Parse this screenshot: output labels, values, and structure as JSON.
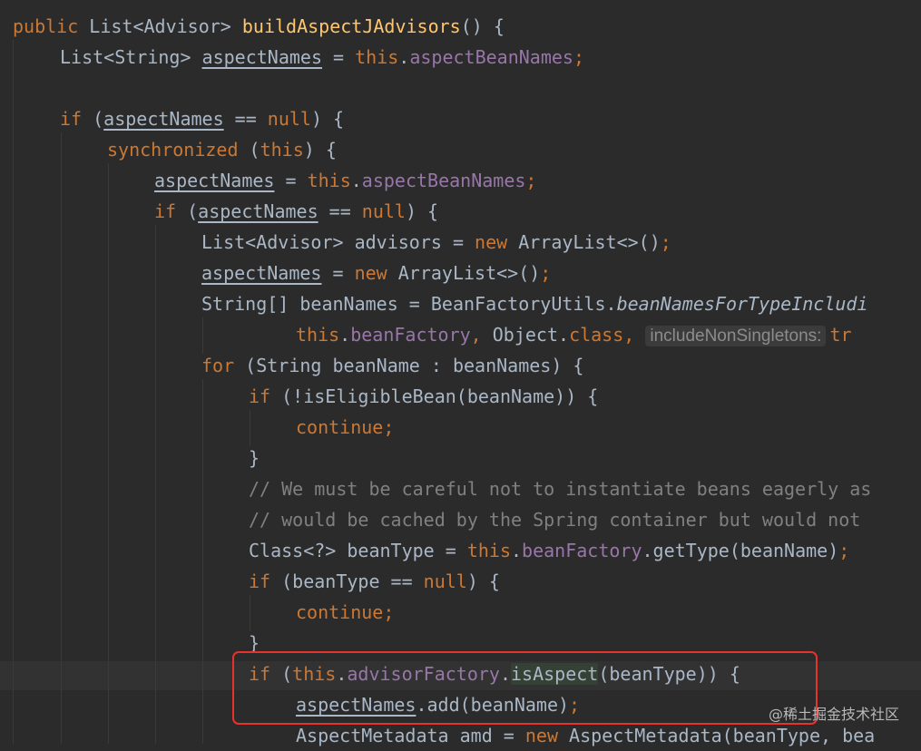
{
  "editor": {
    "lines": [
      {
        "indent": 0,
        "tokens": [
          {
            "t": "public ",
            "c": "kw"
          },
          {
            "t": "List<Advisor> ",
            "c": "pl"
          },
          {
            "t": "buildAspectJAdvisors",
            "c": "fn"
          },
          {
            "t": "() {",
            "c": "pl"
          }
        ]
      },
      {
        "indent": 1,
        "tokens": [
          {
            "t": "List<String> ",
            "c": "pl"
          },
          {
            "t": "aspectNames",
            "c": "pl ul"
          },
          {
            "t": " = ",
            "c": "pl"
          },
          {
            "t": "this",
            "c": "kw"
          },
          {
            "t": ".",
            "c": "pl"
          },
          {
            "t": "aspectBeanNames",
            "c": "fld"
          },
          {
            "t": ";",
            "c": "kw"
          }
        ]
      },
      {
        "indent": 0,
        "tokens": []
      },
      {
        "indent": 1,
        "tokens": [
          {
            "t": "if ",
            "c": "kw"
          },
          {
            "t": "(",
            "c": "pl"
          },
          {
            "t": "aspectNames",
            "c": "pl ul"
          },
          {
            "t": " == ",
            "c": "pl"
          },
          {
            "t": "null",
            "c": "kw"
          },
          {
            "t": ") {",
            "c": "pl"
          }
        ]
      },
      {
        "indent": 2,
        "tokens": [
          {
            "t": "synchronized ",
            "c": "kw"
          },
          {
            "t": "(",
            "c": "pl"
          },
          {
            "t": "this",
            "c": "kw"
          },
          {
            "t": ") {",
            "c": "pl"
          }
        ]
      },
      {
        "indent": 3,
        "tokens": [
          {
            "t": "aspectNames",
            "c": "pl ul"
          },
          {
            "t": " = ",
            "c": "pl"
          },
          {
            "t": "this",
            "c": "kw"
          },
          {
            "t": ".",
            "c": "pl"
          },
          {
            "t": "aspectBeanNames",
            "c": "fld"
          },
          {
            "t": ";",
            "c": "kw"
          }
        ]
      },
      {
        "indent": 3,
        "tokens": [
          {
            "t": "if ",
            "c": "kw"
          },
          {
            "t": "(",
            "c": "pl"
          },
          {
            "t": "aspectNames",
            "c": "pl ul"
          },
          {
            "t": " == ",
            "c": "pl"
          },
          {
            "t": "null",
            "c": "kw"
          },
          {
            "t": ") {",
            "c": "pl"
          }
        ]
      },
      {
        "indent": 4,
        "tokens": [
          {
            "t": "List<Advisor> advisors = ",
            "c": "pl"
          },
          {
            "t": "new ",
            "c": "kw"
          },
          {
            "t": "ArrayList<>()",
            "c": "pl"
          },
          {
            "t": ";",
            "c": "kw"
          }
        ]
      },
      {
        "indent": 4,
        "tokens": [
          {
            "t": "aspectNames",
            "c": "pl ul"
          },
          {
            "t": " = ",
            "c": "pl"
          },
          {
            "t": "new ",
            "c": "kw"
          },
          {
            "t": "ArrayList<>()",
            "c": "pl"
          },
          {
            "t": ";",
            "c": "kw"
          }
        ]
      },
      {
        "indent": 4,
        "tokens": [
          {
            "t": "String[] beanNames = BeanFactoryUtils.",
            "c": "pl"
          },
          {
            "t": "beanNamesForTypeIncludi",
            "c": "pl it"
          }
        ]
      },
      {
        "indent": 6,
        "tokens": [
          {
            "t": "this",
            "c": "kw"
          },
          {
            "t": ".",
            "c": "pl"
          },
          {
            "t": "beanFactory",
            "c": "fld"
          },
          {
            "t": ", ",
            "c": "kw"
          },
          {
            "t": "Object.",
            "c": "pl"
          },
          {
            "t": "class",
            "c": "kw"
          },
          {
            "t": ", ",
            "c": "kw"
          },
          {
            "t": "includeNonSingletons:",
            "c": "hint"
          },
          {
            "t": "tr",
            "c": "kw"
          }
        ]
      },
      {
        "indent": 4,
        "tokens": [
          {
            "t": "for ",
            "c": "kw"
          },
          {
            "t": "(String beanName : beanNames) {",
            "c": "pl"
          }
        ]
      },
      {
        "indent": 5,
        "tokens": [
          {
            "t": "if ",
            "c": "kw"
          },
          {
            "t": "(!isEligibleBean(beanName)) {",
            "c": "pl"
          }
        ]
      },
      {
        "indent": 6,
        "tokens": [
          {
            "t": "continue",
            "c": "kw"
          },
          {
            "t": ";",
            "c": "kw"
          }
        ]
      },
      {
        "indent": 5,
        "tokens": [
          {
            "t": "}",
            "c": "pl"
          }
        ]
      },
      {
        "indent": 5,
        "tokens": [
          {
            "t": "// We must be careful not to instantiate beans eagerly as",
            "c": "cm"
          }
        ]
      },
      {
        "indent": 5,
        "tokens": [
          {
            "t": "// would be cached by the Spring container but would not",
            "c": "cm"
          }
        ]
      },
      {
        "indent": 5,
        "tokens": [
          {
            "t": "Class<?> beanType = ",
            "c": "pl"
          },
          {
            "t": "this",
            "c": "kw"
          },
          {
            "t": ".",
            "c": "pl"
          },
          {
            "t": "beanFactory",
            "c": "fld"
          },
          {
            "t": ".getType(beanName)",
            "c": "pl"
          },
          {
            "t": ";",
            "c": "kw"
          }
        ]
      },
      {
        "indent": 5,
        "tokens": [
          {
            "t": "if ",
            "c": "kw"
          },
          {
            "t": "(beanType == ",
            "c": "pl"
          },
          {
            "t": "null",
            "c": "kw"
          },
          {
            "t": ") {",
            "c": "pl"
          }
        ]
      },
      {
        "indent": 6,
        "tokens": [
          {
            "t": "continue",
            "c": "kw"
          },
          {
            "t": ";",
            "c": "kw"
          }
        ]
      },
      {
        "indent": 5,
        "tokens": [
          {
            "t": "}",
            "c": "pl"
          }
        ]
      },
      {
        "indent": 5,
        "tokens": [
          {
            "t": "if ",
            "c": "kw"
          },
          {
            "t": "(",
            "c": "pl"
          },
          {
            "t": "this",
            "c": "kw"
          },
          {
            "t": ".",
            "c": "pl"
          },
          {
            "t": "advisorFactory",
            "c": "fld"
          },
          {
            "t": ".",
            "c": "pl"
          },
          {
            "t": "isAspect",
            "c": "pl hl-bg"
          },
          {
            "t": "(beanType)) {",
            "c": "pl"
          }
        ]
      },
      {
        "indent": 6,
        "tokens": [
          {
            "t": "aspectNames",
            "c": "pl ul"
          },
          {
            "t": ".add(beanName)",
            "c": "pl"
          },
          {
            "t": ";",
            "c": "kw"
          }
        ]
      },
      {
        "indent": 6,
        "tokens": [
          {
            "t": "AspectMetadata amd = ",
            "c": "pl"
          },
          {
            "t": "new ",
            "c": "kw"
          },
          {
            "t": "AspectMetadata(beanType, bea",
            "c": "pl"
          }
        ]
      }
    ]
  },
  "watermark": "@稀土掘金技术社区",
  "colors": {
    "background": "#2b2b2b",
    "keyword": "#cc7832",
    "method": "#ffc66d",
    "field": "#9876aa",
    "plain": "#a9b7c6",
    "comment": "#808080",
    "highlight_box": "#e8322e"
  }
}
